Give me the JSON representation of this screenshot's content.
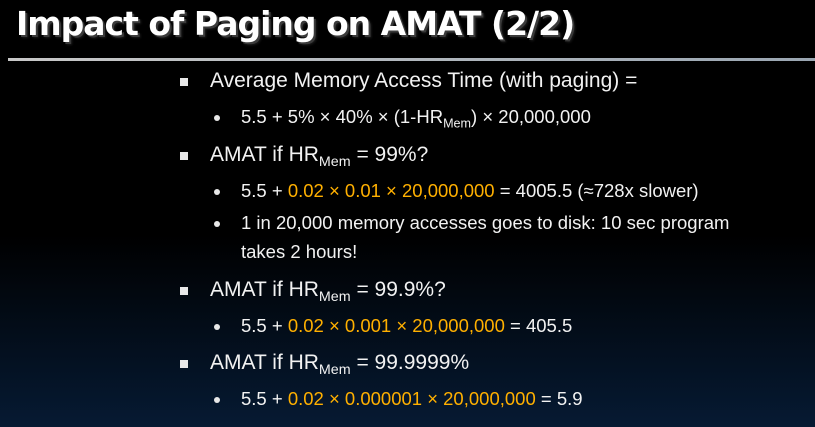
{
  "title": "Impact of Paging on AMAT (2/2)",
  "b1": {
    "text": "Average Memory Access Time (with paging) =",
    "sub": "5.5 + 5% × 40% ×  (1-HR",
    "sub_mem": "Mem",
    "sub_tail": ") × 20,000,000"
  },
  "b2": {
    "pre": "AMAT if  HR",
    "mem": "Mem",
    "post": " = 99%?",
    "s1_pre": "5.5 + ",
    "s1_hl": "0.02 × 0.01 × 20,000,000",
    "s1_post": " = 4005.5  (≈728x slower)",
    "s2_line1": "1 in 20,000 memory accesses goes to disk: 10 sec program",
    "s2_line2": "takes 2 hours!"
  },
  "b3": {
    "pre": "AMAT if  HR",
    "mem": "Mem",
    "post": " = 99.9%?",
    "s1_pre": "5.5 + ",
    "s1_hl": "0.02 × 0.001 × 20,000,000",
    "s1_post": " = 405.5"
  },
  "b4": {
    "pre": "AMAT if HR",
    "mem": "Mem",
    "post": " = 99.9999%",
    "s1_pre": "5.5 + ",
    "s1_hl": "0.02 × 0.000001 × 20,000,000",
    "s1_post": " = 5.9"
  }
}
